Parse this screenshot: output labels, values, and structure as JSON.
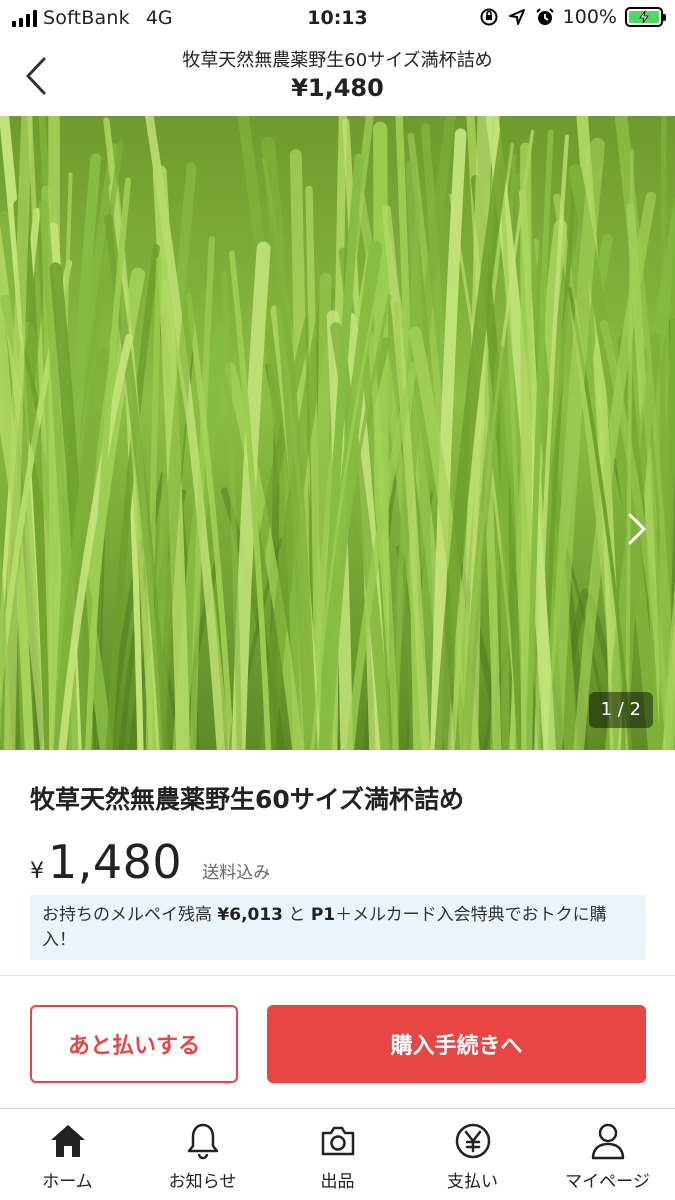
{
  "status_bar": {
    "carrier": "SoftBank",
    "network": "4G",
    "time": "10:13",
    "battery_percent": "100%",
    "battery_level": 1.0,
    "icons": [
      "orientation-lock-icon",
      "location-icon",
      "alarm-icon",
      "battery-charging-icon"
    ]
  },
  "header": {
    "title": "牧草天然無農薬野生60サイズ満杯詰め",
    "price": "¥1,480",
    "back_icon": "chevron-left-icon"
  },
  "photo": {
    "counter": "1 / 2",
    "next_icon": "chevron-right-icon"
  },
  "item": {
    "title": "牧草天然無農薬野生60サイズ満杯詰め",
    "currency": "¥",
    "price": "1,480",
    "shipping": "送料込み"
  },
  "promo": {
    "part1": "お持ちのメルペイ残高 ",
    "balance": "¥6,013",
    "part2": " と ",
    "points": "P1",
    "part3": "＋メルカード入会特典でおトクに購入！"
  },
  "actions": {
    "later_label": "あと払いする",
    "buy_label": "購入手続きへ",
    "accent_color": "#e84545"
  },
  "tabbar": {
    "items": [
      {
        "label": "ホーム",
        "icon": "home-icon"
      },
      {
        "label": "お知らせ",
        "icon": "bell-icon"
      },
      {
        "label": "出品",
        "icon": "camera-icon"
      },
      {
        "label": "支払い",
        "icon": "yen-icon"
      },
      {
        "label": "マイページ",
        "icon": "person-icon"
      }
    ]
  }
}
